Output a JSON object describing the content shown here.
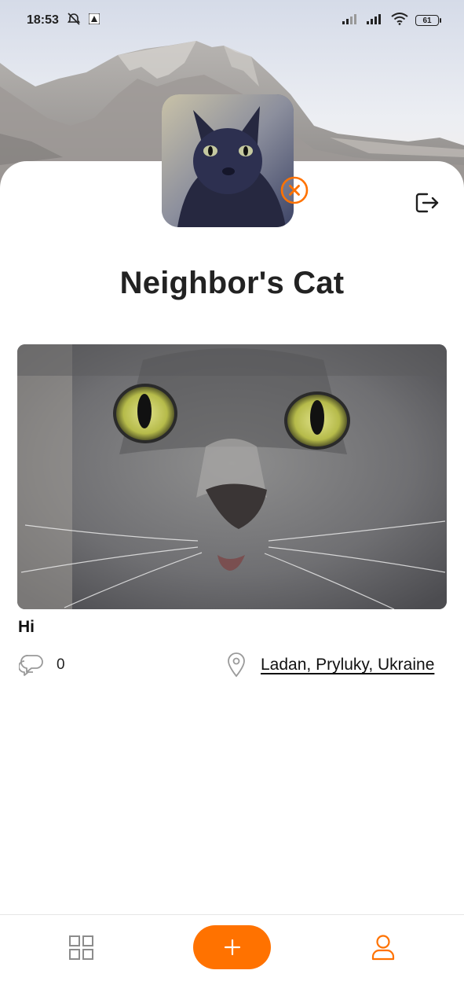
{
  "status_bar": {
    "time": "18:53",
    "battery": "61",
    "icons": [
      "muted-alarm-icon",
      "notification-icon",
      "signal-icon",
      "signal-icon",
      "wifi-icon",
      "battery-icon"
    ]
  },
  "profile": {
    "name": "Neighbor's Cat",
    "avatar_icon": "cat-avatar",
    "remove_avatar_icon": "close-circle-icon",
    "logout_icon": "logout-icon"
  },
  "post": {
    "text": "Hi",
    "comments_count": "0",
    "location": "Ladan, Pryluky, Ukraine",
    "comments_icon": "comments-icon",
    "location_icon": "map-pin-icon"
  },
  "bottom_nav": {
    "items": [
      "grid-icon",
      "plus-icon",
      "user-icon"
    ],
    "accent_color": "#ff7200"
  },
  "colors": {
    "accent": "#ff7200",
    "text": "#222222",
    "icon_gray": "#8c8c8c"
  }
}
